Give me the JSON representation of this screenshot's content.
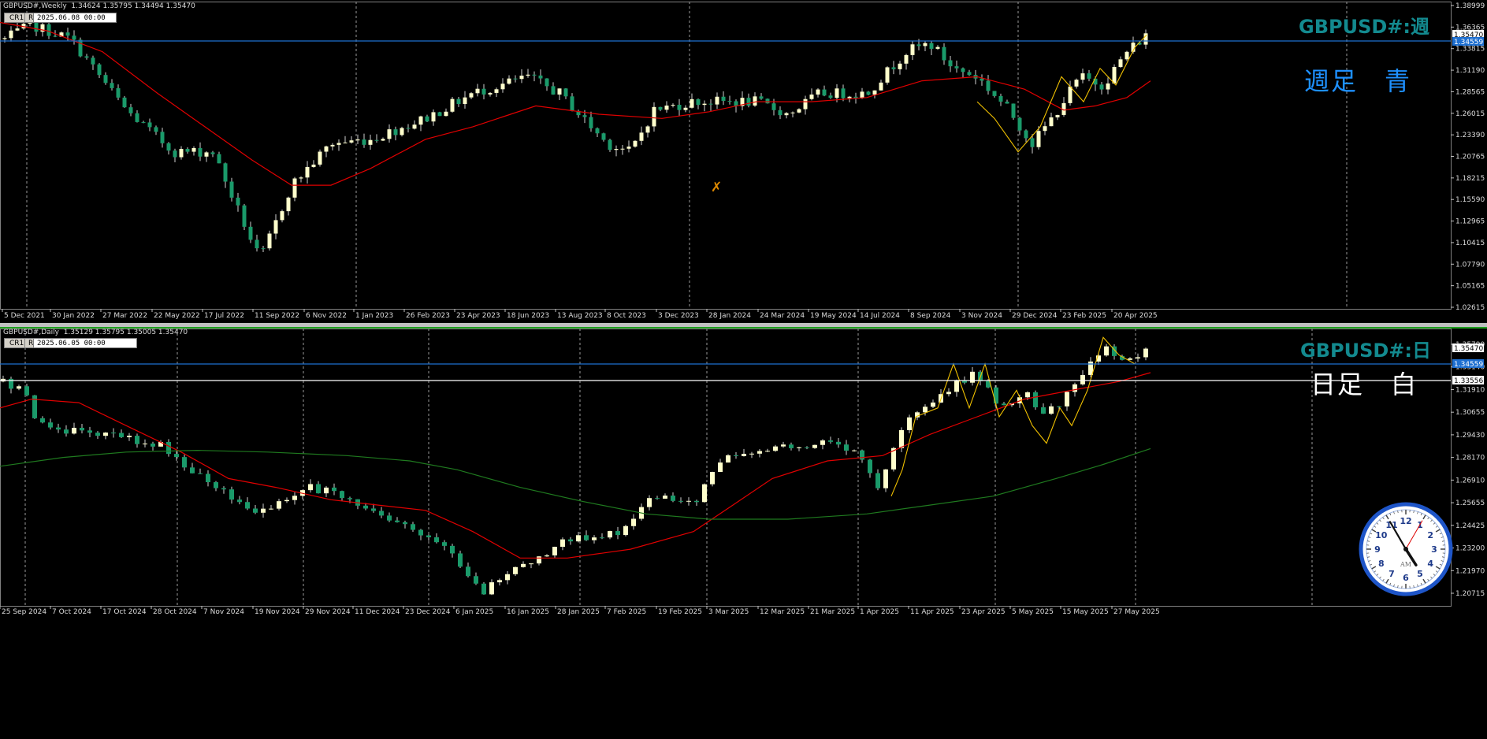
{
  "top_pane": {
    "header": "GBPUSD#,Weekly  1.34624 1.35795 1.34494 1.35470",
    "cr_button": "CR1",
    "r_button": "R",
    "date_box": "2025.06.08 00:00",
    "symbol_label": "GBPUSD#:週",
    "note": "週足　青",
    "price_ticks": [
      "1.38999",
      "1.36365",
      "1.33815",
      "1.31190",
      "1.28565",
      "1.26015",
      "1.23390",
      "1.20765",
      "1.18215",
      "1.15590",
      "1.12965",
      "1.10415",
      "1.07790",
      "1.05165",
      "1.02615"
    ],
    "price_badges": [
      "1.35470",
      "1.34559"
    ],
    "date_ticks": [
      "5 Dec 2021",
      "30 Jan 2022",
      "27 Mar 2022",
      "22 May 2022",
      "17 Jul 2022",
      "11 Sep 2022",
      "6 Nov 2022",
      "1 Jan 2023",
      "26 Feb 2023",
      "23 Apr 2023",
      "18 Jun 2023",
      "13 Aug 2023",
      "8 Oct 2023",
      "3 Dec 2023",
      "28 Jan 2024",
      "24 Mar 2024",
      "19 May 2024",
      "14 Jul 2024",
      "8 Sep 2024",
      "3 Nov 2024",
      "29 Dec 2024",
      "23 Feb 2025",
      "20 Apr 2025"
    ]
  },
  "bottom_pane": {
    "header": "GBPUSD#,Daily  1.35129 1.35795 1.35005 1.35470",
    "cr_button": "CR1",
    "r_button": "R",
    "date_box": "2025.06.05 00:00",
    "symbol_label": "GBPUSD#:日",
    "note": "日足　白",
    "price_ticks": [
      "1.35790",
      "1.33140",
      "1.31910",
      "1.30655",
      "1.29430",
      "1.28170",
      "1.26910",
      "1.25655",
      "1.24425",
      "1.23200",
      "1.21970",
      "1.20715"
    ],
    "price_badges": [
      "1.35470",
      "1.34559",
      "1.33556"
    ],
    "date_ticks": [
      "25 Sep 2024",
      "7 Oct 2024",
      "17 Oct 2024",
      "28 Oct 2024",
      "7 Nov 2024",
      "19 Nov 2024",
      "29 Nov 2024",
      "11 Dec 2024",
      "23 Dec 2024",
      "6 Jan 2025",
      "16 Jan 2025",
      "28 Jan 2025",
      "7 Feb 2025",
      "19 Feb 2025",
      "3 Mar 2025",
      "12 Mar 2025",
      "21 Mar 2025",
      "1 Apr 2025",
      "11 Apr 2025",
      "23 Apr 2025",
      "5 May 2025",
      "15 May 2025",
      "27 May 2025"
    ]
  },
  "clock": {
    "am_label": "AM",
    "numbers": [
      "12",
      "1",
      "2",
      "3",
      "4",
      "5",
      "6",
      "7",
      "8",
      "9",
      "10",
      "11"
    ],
    "hour": 4,
    "minute": 55,
    "second": 5
  },
  "colors": {
    "bull": "#ffffcc",
    "bear": "#1a9a6a",
    "wick": "#d0d0d0",
    "ma_red": "#e00000",
    "ma_green": "#1f7a1f",
    "zigzag": "#f0c000",
    "hline_blue": "#1e6fd0",
    "hline_white": "#ffffff",
    "grid": "#9a9a9a",
    "label_teal": "#138a8f",
    "note_blue": "#1e90ff",
    "note_white": "#ffffff"
  }
}
